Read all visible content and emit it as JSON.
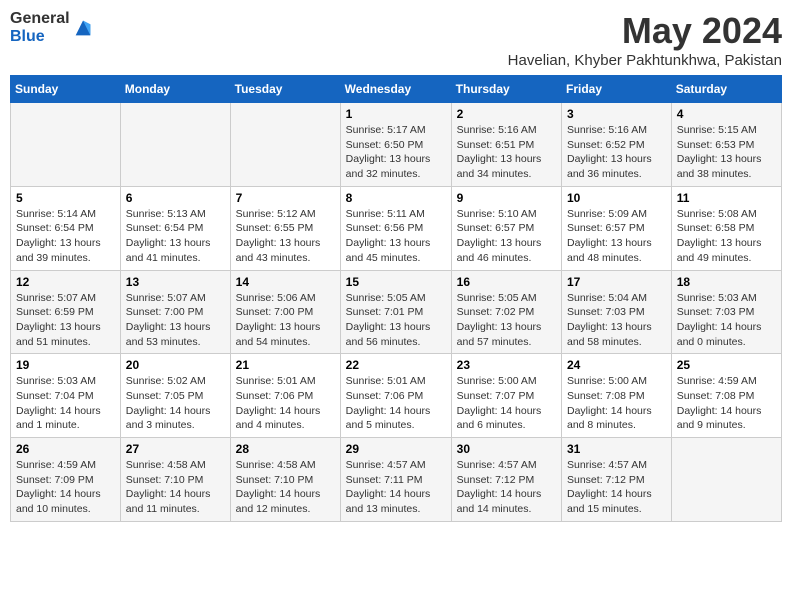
{
  "logo": {
    "general": "General",
    "blue": "Blue"
  },
  "title": "May 2024",
  "location": "Havelian, Khyber Pakhtunkhwa, Pakistan",
  "days_of_week": [
    "Sunday",
    "Monday",
    "Tuesday",
    "Wednesday",
    "Thursday",
    "Friday",
    "Saturday"
  ],
  "weeks": [
    [
      {
        "day": "",
        "info": ""
      },
      {
        "day": "",
        "info": ""
      },
      {
        "day": "",
        "info": ""
      },
      {
        "day": "1",
        "info": "Sunrise: 5:17 AM\nSunset: 6:50 PM\nDaylight: 13 hours\nand 32 minutes."
      },
      {
        "day": "2",
        "info": "Sunrise: 5:16 AM\nSunset: 6:51 PM\nDaylight: 13 hours\nand 34 minutes."
      },
      {
        "day": "3",
        "info": "Sunrise: 5:16 AM\nSunset: 6:52 PM\nDaylight: 13 hours\nand 36 minutes."
      },
      {
        "day": "4",
        "info": "Sunrise: 5:15 AM\nSunset: 6:53 PM\nDaylight: 13 hours\nand 38 minutes."
      }
    ],
    [
      {
        "day": "5",
        "info": "Sunrise: 5:14 AM\nSunset: 6:54 PM\nDaylight: 13 hours\nand 39 minutes."
      },
      {
        "day": "6",
        "info": "Sunrise: 5:13 AM\nSunset: 6:54 PM\nDaylight: 13 hours\nand 41 minutes."
      },
      {
        "day": "7",
        "info": "Sunrise: 5:12 AM\nSunset: 6:55 PM\nDaylight: 13 hours\nand 43 minutes."
      },
      {
        "day": "8",
        "info": "Sunrise: 5:11 AM\nSunset: 6:56 PM\nDaylight: 13 hours\nand 45 minutes."
      },
      {
        "day": "9",
        "info": "Sunrise: 5:10 AM\nSunset: 6:57 PM\nDaylight: 13 hours\nand 46 minutes."
      },
      {
        "day": "10",
        "info": "Sunrise: 5:09 AM\nSunset: 6:57 PM\nDaylight: 13 hours\nand 48 minutes."
      },
      {
        "day": "11",
        "info": "Sunrise: 5:08 AM\nSunset: 6:58 PM\nDaylight: 13 hours\nand 49 minutes."
      }
    ],
    [
      {
        "day": "12",
        "info": "Sunrise: 5:07 AM\nSunset: 6:59 PM\nDaylight: 13 hours\nand 51 minutes."
      },
      {
        "day": "13",
        "info": "Sunrise: 5:07 AM\nSunset: 7:00 PM\nDaylight: 13 hours\nand 53 minutes."
      },
      {
        "day": "14",
        "info": "Sunrise: 5:06 AM\nSunset: 7:00 PM\nDaylight: 13 hours\nand 54 minutes."
      },
      {
        "day": "15",
        "info": "Sunrise: 5:05 AM\nSunset: 7:01 PM\nDaylight: 13 hours\nand 56 minutes."
      },
      {
        "day": "16",
        "info": "Sunrise: 5:05 AM\nSunset: 7:02 PM\nDaylight: 13 hours\nand 57 minutes."
      },
      {
        "day": "17",
        "info": "Sunrise: 5:04 AM\nSunset: 7:03 PM\nDaylight: 13 hours\nand 58 minutes."
      },
      {
        "day": "18",
        "info": "Sunrise: 5:03 AM\nSunset: 7:03 PM\nDaylight: 14 hours\nand 0 minutes."
      }
    ],
    [
      {
        "day": "19",
        "info": "Sunrise: 5:03 AM\nSunset: 7:04 PM\nDaylight: 14 hours\nand 1 minute."
      },
      {
        "day": "20",
        "info": "Sunrise: 5:02 AM\nSunset: 7:05 PM\nDaylight: 14 hours\nand 3 minutes."
      },
      {
        "day": "21",
        "info": "Sunrise: 5:01 AM\nSunset: 7:06 PM\nDaylight: 14 hours\nand 4 minutes."
      },
      {
        "day": "22",
        "info": "Sunrise: 5:01 AM\nSunset: 7:06 PM\nDaylight: 14 hours\nand 5 minutes."
      },
      {
        "day": "23",
        "info": "Sunrise: 5:00 AM\nSunset: 7:07 PM\nDaylight: 14 hours\nand 6 minutes."
      },
      {
        "day": "24",
        "info": "Sunrise: 5:00 AM\nSunset: 7:08 PM\nDaylight: 14 hours\nand 8 minutes."
      },
      {
        "day": "25",
        "info": "Sunrise: 4:59 AM\nSunset: 7:08 PM\nDaylight: 14 hours\nand 9 minutes."
      }
    ],
    [
      {
        "day": "26",
        "info": "Sunrise: 4:59 AM\nSunset: 7:09 PM\nDaylight: 14 hours\nand 10 minutes."
      },
      {
        "day": "27",
        "info": "Sunrise: 4:58 AM\nSunset: 7:10 PM\nDaylight: 14 hours\nand 11 minutes."
      },
      {
        "day": "28",
        "info": "Sunrise: 4:58 AM\nSunset: 7:10 PM\nDaylight: 14 hours\nand 12 minutes."
      },
      {
        "day": "29",
        "info": "Sunrise: 4:57 AM\nSunset: 7:11 PM\nDaylight: 14 hours\nand 13 minutes."
      },
      {
        "day": "30",
        "info": "Sunrise: 4:57 AM\nSunset: 7:12 PM\nDaylight: 14 hours\nand 14 minutes."
      },
      {
        "day": "31",
        "info": "Sunrise: 4:57 AM\nSunset: 7:12 PM\nDaylight: 14 hours\nand 15 minutes."
      },
      {
        "day": "",
        "info": ""
      }
    ]
  ]
}
